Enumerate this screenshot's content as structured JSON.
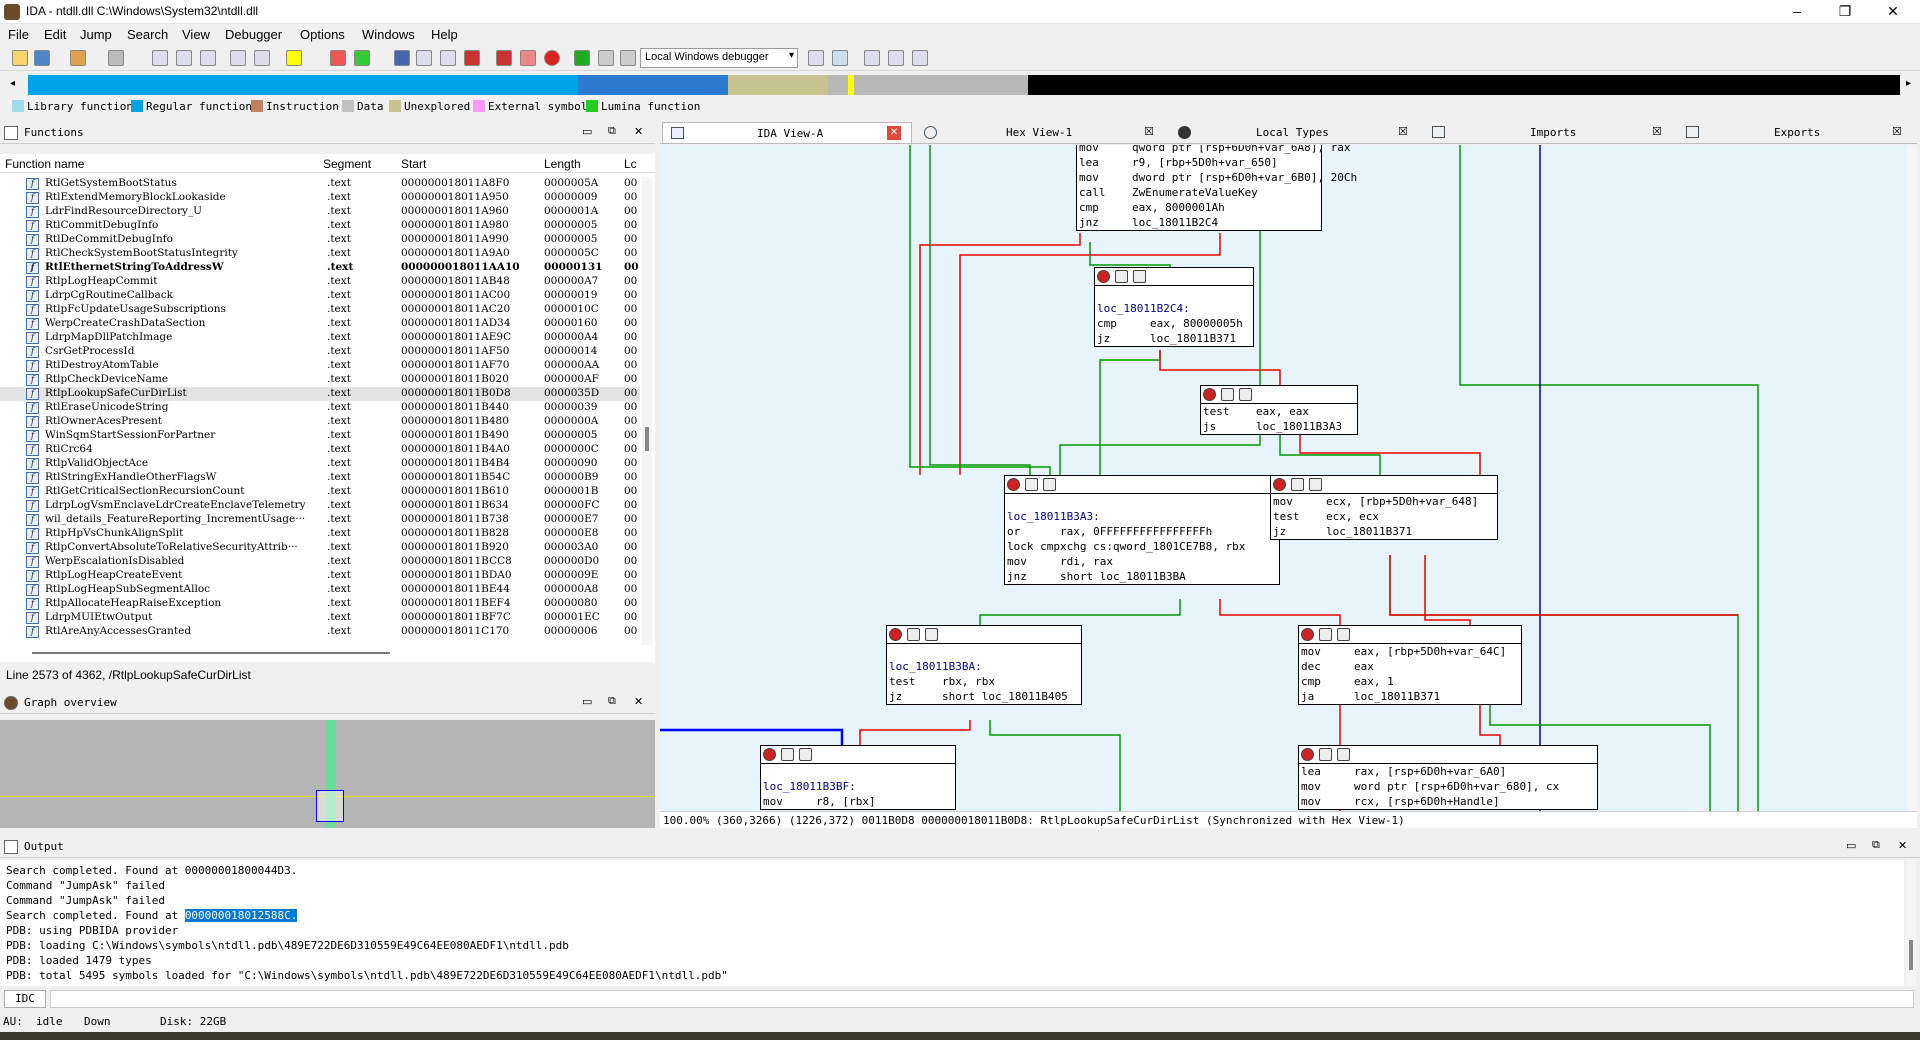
{
  "window": {
    "title": "IDA - ntdll.dll C:\\Windows\\System32\\ntdll.dll",
    "minimize": "–",
    "maximize": "❐",
    "close": "✕"
  },
  "menu": [
    "File",
    "Edit",
    "Jump",
    "Search",
    "View",
    "Debugger",
    "Options",
    "Windows",
    "Help"
  ],
  "toolbar": {
    "debugger_select": "Local Windows debugger"
  },
  "legend": [
    {
      "label": "Library function",
      "color": "#9fdce9"
    },
    {
      "label": "Regular function",
      "color": "#00a2e8"
    },
    {
      "label": "Instruction",
      "color": "#c08060"
    },
    {
      "label": "Data",
      "color": "#c0c0c0"
    },
    {
      "label": "Unexplored",
      "color": "#c7c38f"
    },
    {
      "label": "External symbol",
      "color": "#ff99ff"
    },
    {
      "label": "Lumina function",
      "color": "#22cc22"
    }
  ],
  "functions_panel": {
    "title": "Functions",
    "columns": [
      "Function name",
      "Segment",
      "Start",
      "Length",
      "Lc"
    ],
    "rows": [
      {
        "name": "RtlGetSystemBootStatus",
        "seg": ".text",
        "start": "000000018011A8F0",
        "len": "0000005A",
        "lc": "00"
      },
      {
        "name": "RtlExtendMemoryBlockLookaside",
        "seg": ".text",
        "start": "000000018011A950",
        "len": "00000009",
        "lc": "00"
      },
      {
        "name": "LdrFindResourceDirectory_U",
        "seg": ".text",
        "start": "000000018011A960",
        "len": "0000001A",
        "lc": "00"
      },
      {
        "name": "RtlCommitDebugInfo",
        "seg": ".text",
        "start": "000000018011A980",
        "len": "00000005",
        "lc": "00"
      },
      {
        "name": "RtlDeCommitDebugInfo",
        "seg": ".text",
        "start": "000000018011A990",
        "len": "00000005",
        "lc": "00"
      },
      {
        "name": "RtlCheckSystemBootStatusIntegrity",
        "seg": ".text",
        "start": "000000018011A9A0",
        "len": "0000005C",
        "lc": "00"
      },
      {
        "name": "RtlEthernetStringToAddressW",
        "seg": ".text",
        "start": "000000018011AA10",
        "len": "00000131",
        "lc": "00",
        "bold": true
      },
      {
        "name": "RtlpLogHeapCommit",
        "seg": ".text",
        "start": "000000018011AB48",
        "len": "000000A7",
        "lc": "00"
      },
      {
        "name": "LdrpCgRoutineCallback",
        "seg": ".text",
        "start": "000000018011AC00",
        "len": "00000019",
        "lc": "00"
      },
      {
        "name": "RtlpFcUpdateUsageSubscriptions",
        "seg": ".text",
        "start": "000000018011AC20",
        "len": "0000010C",
        "lc": "00"
      },
      {
        "name": "WerpCreateCrashDataSection",
        "seg": ".text",
        "start": "000000018011AD34",
        "len": "00000160",
        "lc": "00"
      },
      {
        "name": "LdrpMapDllPatchImage",
        "seg": ".text",
        "start": "000000018011AE9C",
        "len": "000000A4",
        "lc": "00"
      },
      {
        "name": "CsrGetProcessId",
        "seg": ".text",
        "start": "000000018011AF50",
        "len": "00000014",
        "lc": "00"
      },
      {
        "name": "RtlDestroyAtomTable",
        "seg": ".text",
        "start": "000000018011AF70",
        "len": "000000AA",
        "lc": "00"
      },
      {
        "name": "RtlpCheckDeviceName",
        "seg": ".text",
        "start": "000000018011B020",
        "len": "000000AF",
        "lc": "00"
      },
      {
        "name": "RtlpLookupSafeCurDirList",
        "seg": ".text",
        "start": "000000018011B0D8",
        "len": "0000035D",
        "lc": "00",
        "selected": true
      },
      {
        "name": "RtlEraseUnicodeString",
        "seg": ".text",
        "start": "000000018011B440",
        "len": "00000039",
        "lc": "00"
      },
      {
        "name": "RtlOwnerAcesPresent",
        "seg": ".text",
        "start": "000000018011B480",
        "len": "0000000A",
        "lc": "00"
      },
      {
        "name": "WinSqmStartSessionForPartner",
        "seg": ".text",
        "start": "000000018011B490",
        "len": "00000005",
        "lc": "00"
      },
      {
        "name": "RtlCrc64",
        "seg": ".text",
        "start": "000000018011B4A0",
        "len": "0000000C",
        "lc": "00"
      },
      {
        "name": "RtlpValidObjectAce",
        "seg": ".text",
        "start": "000000018011B4B4",
        "len": "00000090",
        "lc": "00"
      },
      {
        "name": "RtlStringExHandleOtherFlagsW",
        "seg": ".text",
        "start": "000000018011B54C",
        "len": "000000B9",
        "lc": "00"
      },
      {
        "name": "RtlGetCriticalSectionRecursionCount",
        "seg": ".text",
        "start": "000000018011B610",
        "len": "0000001B",
        "lc": "00"
      },
      {
        "name": "LdrpLogVsmEnclaveLdrCreateEnclaveTelemetry",
        "seg": ".text",
        "start": "000000018011B634",
        "len": "000000FC",
        "lc": "00"
      },
      {
        "name": "wil_details_FeatureReporting_IncrementUsage···",
        "seg": ".text",
        "start": "000000018011B738",
        "len": "000000E7",
        "lc": "00"
      },
      {
        "name": "RtlpHpVsChunkAlignSplit",
        "seg": ".text",
        "start": "000000018011B828",
        "len": "000000E8",
        "lc": "00"
      },
      {
        "name": "RtlpConvertAbsoluteToRelativeSecurityAttrib···",
        "seg": ".text",
        "start": "000000018011B920",
        "len": "000003A0",
        "lc": "00"
      },
      {
        "name": "WerpEscalationIsDisabled",
        "seg": ".text",
        "start": "000000018011BCC8",
        "len": "000000D0",
        "lc": "00"
      },
      {
        "name": "RtlpLogHeapCreateEvent",
        "seg": ".text",
        "start": "000000018011BDA0",
        "len": "0000009E",
        "lc": "00"
      },
      {
        "name": "RtlpLogHeapSubSegmentAlloc",
        "seg": ".text",
        "start": "000000018011BE44",
        "len": "000000A8",
        "lc": "00"
      },
      {
        "name": "RtlpAllocateHeapRaiseException",
        "seg": ".text",
        "start": "000000018011BEF4",
        "len": "00000080",
        "lc": "00"
      },
      {
        "name": "LdrpMUIEtwOutput",
        "seg": ".text",
        "start": "000000018011BF7C",
        "len": "000001EC",
        "lc": "00"
      },
      {
        "name": "RtlAreAnyAccessesGranted",
        "seg": ".text",
        "start": "000000018011C170",
        "len": "00000006",
        "lc": "00"
      }
    ],
    "status": "Line 2573 of 4362, /RtlpLookupSafeCurDirList"
  },
  "graph_overview_panel": {
    "title": "Graph overview"
  },
  "tabs": [
    {
      "label": "IDA View-A"
    },
    {
      "label": "Hex View-1"
    },
    {
      "label": "Local Types"
    },
    {
      "label": "Imports"
    },
    {
      "label": "Exports"
    }
  ],
  "graph_nodes": {
    "n0": [
      "mov     qword ptr [rsp+6D0h+var_6A8], rax",
      "lea     r9, [rbp+5D0h+var_650]",
      "mov     dword ptr [rsp+6D0h+var_6B0], 20Ch",
      "call    ZwEnumerateValueKey",
      "cmp     eax, 8000001Ah",
      "jnz     loc_18011B2C4"
    ],
    "n1": [
      "",
      "loc_18011B2C4:",
      "cmp     eax, 80000005h",
      "jz      loc_18011B371"
    ],
    "n2": [
      "test    eax, eax",
      "js      loc_18011B3A3"
    ],
    "n3": [
      "",
      "loc_18011B3A3:",
      "or      rax, 0FFFFFFFFFFFFFFFFh",
      "lock cmpxchg cs:qword_1801CE7B8, rbx",
      "mov     rdi, rax",
      "jnz     short loc_18011B3BA"
    ],
    "n4": [
      "mov     ecx, [rbp+5D0h+var_648]",
      "test    ecx, ecx",
      "jz      loc_18011B371"
    ],
    "n5": [
      "",
      "loc_18011B3BA:",
      "test    rbx, rbx",
      "jz      short loc_18011B405"
    ],
    "n6": [
      "mov     eax, [rbp+5D0h+var_64C]",
      "dec     eax",
      "cmp     eax, 1",
      "ja      loc_18011B371"
    ],
    "n7": [
      "",
      "loc_18011B3BF:",
      "mov     r8, [rbx]"
    ],
    "n8": [
      "lea     rax, [rsp+6D0h+var_6A0]",
      "mov     word ptr [rsp+6D0h+var_680], cx",
      "mov     rcx, [rsp+6D0h+Handle]"
    ]
  },
  "graph_status": "100.00% (360,3266) (1226,372) 0011B0D8 000000018011B0D8: RtlpLookupSafeCurDirList (Synchronized with Hex View-1)",
  "output_panel": {
    "title": "Output",
    "lines": [
      "Search completed. Found at 00000001800044D3.",
      "Command \"JumpAsk\" failed",
      "Command \"JumpAsk\" failed",
      "Search completed. Found at ",
      "PDB: using PDBIDA provider",
      "PDB: loading C:\\Windows\\symbols\\ntdll.pdb\\489E722DE6D310559E49C64EE080AEDF1\\ntdll.pdb",
      "PDB: loaded 1479 types",
      "PDB: total 5495 symbols loaded for \"C:\\Windows\\symbols\\ntdll.pdb\\489E722DE6D310559E49C64EE080AEDF1\\ntdll.pdb\""
    ],
    "highlight": "000000018012588C.",
    "idc_label": "IDC"
  },
  "statusbar": {
    "au": "AU:",
    "state": "idle",
    "dir": "Down",
    "disk": "Disk: 22GB"
  }
}
